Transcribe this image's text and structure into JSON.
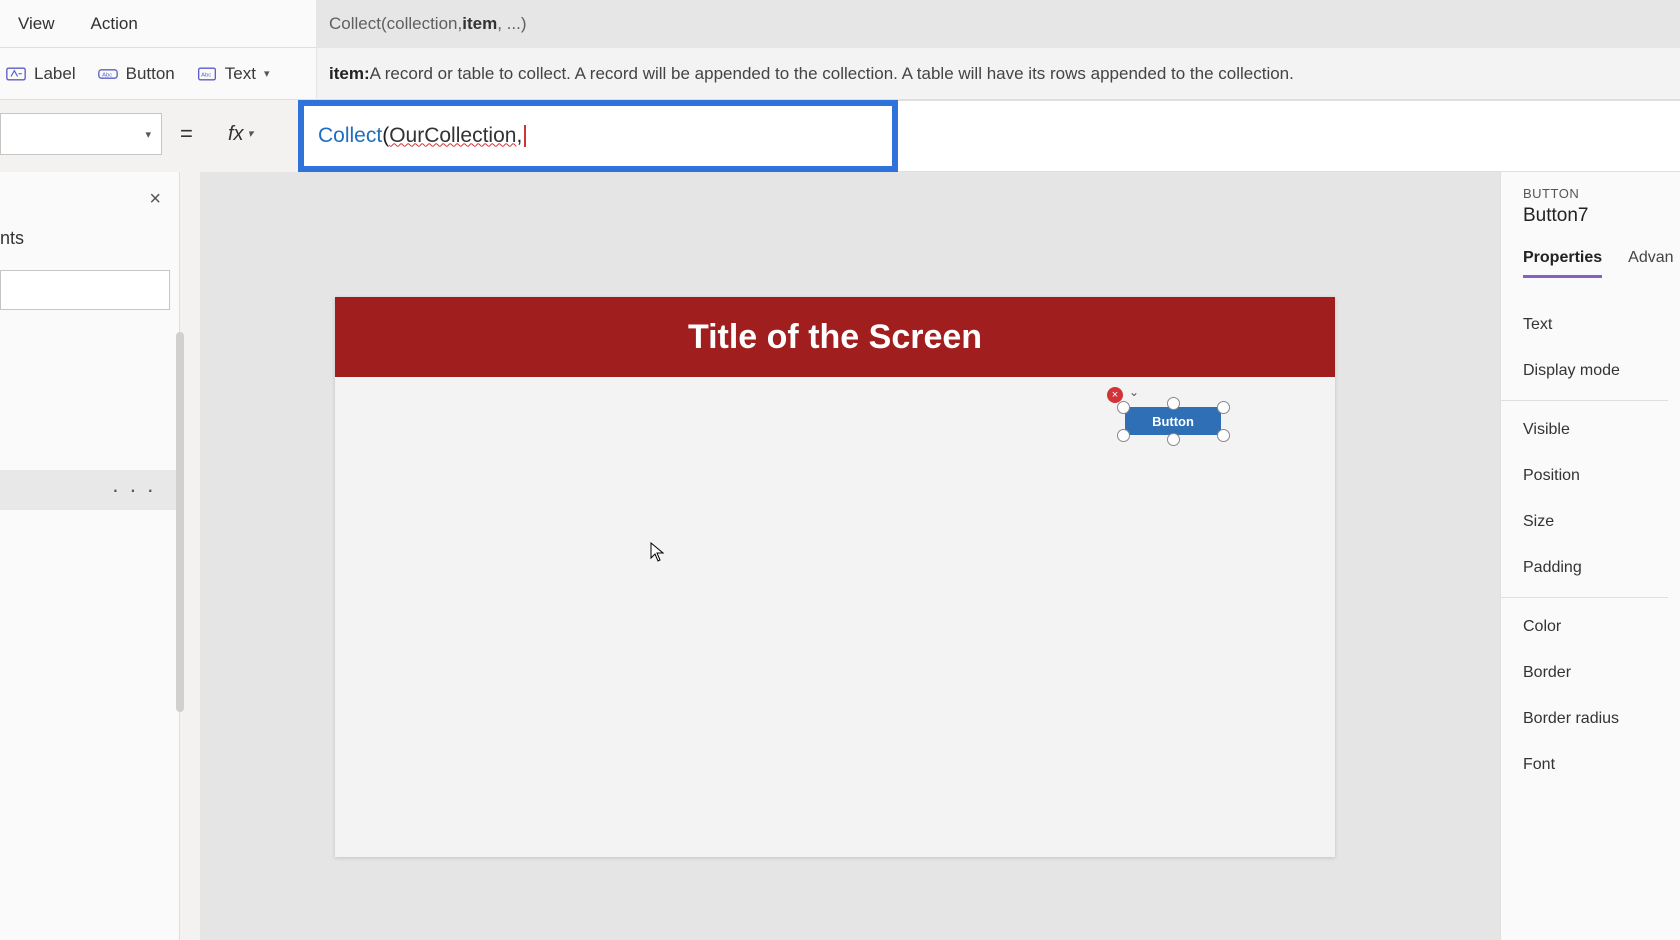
{
  "ribbon": {
    "tabs": {
      "view": "View",
      "action": "Action"
    },
    "signature": {
      "pre": "Collect(collection, ",
      "bold": "item",
      "post": ", ...)"
    },
    "cmds": {
      "label": "Label",
      "button": "Button",
      "text": "Text"
    },
    "help": {
      "bold": "item:",
      "rest": " A record or table to collect. A record will be appended to the collection. A table will have its rows appended to the collection."
    }
  },
  "formula": {
    "equals": "=",
    "fx": "fx",
    "fn": "Collect",
    "paren_open": "(",
    "arg": "OurCollection",
    "comma": ","
  },
  "tree": {
    "close": "×",
    "header": "nts",
    "ellipsis": "· · ·"
  },
  "canvas": {
    "title": "Title of the Screen",
    "button_text": "Button",
    "err": "×",
    "chev": "⌄"
  },
  "props": {
    "type": "BUTTON",
    "name": "Button7",
    "tabs": {
      "properties": "Properties",
      "advanced": "Advan"
    },
    "rows": {
      "text": "Text",
      "display_mode": "Display mode",
      "visible": "Visible",
      "position": "Position",
      "size": "Size",
      "padding": "Padding",
      "color": "Color",
      "border": "Border",
      "border_radius": "Border radius",
      "font": "Font"
    }
  }
}
